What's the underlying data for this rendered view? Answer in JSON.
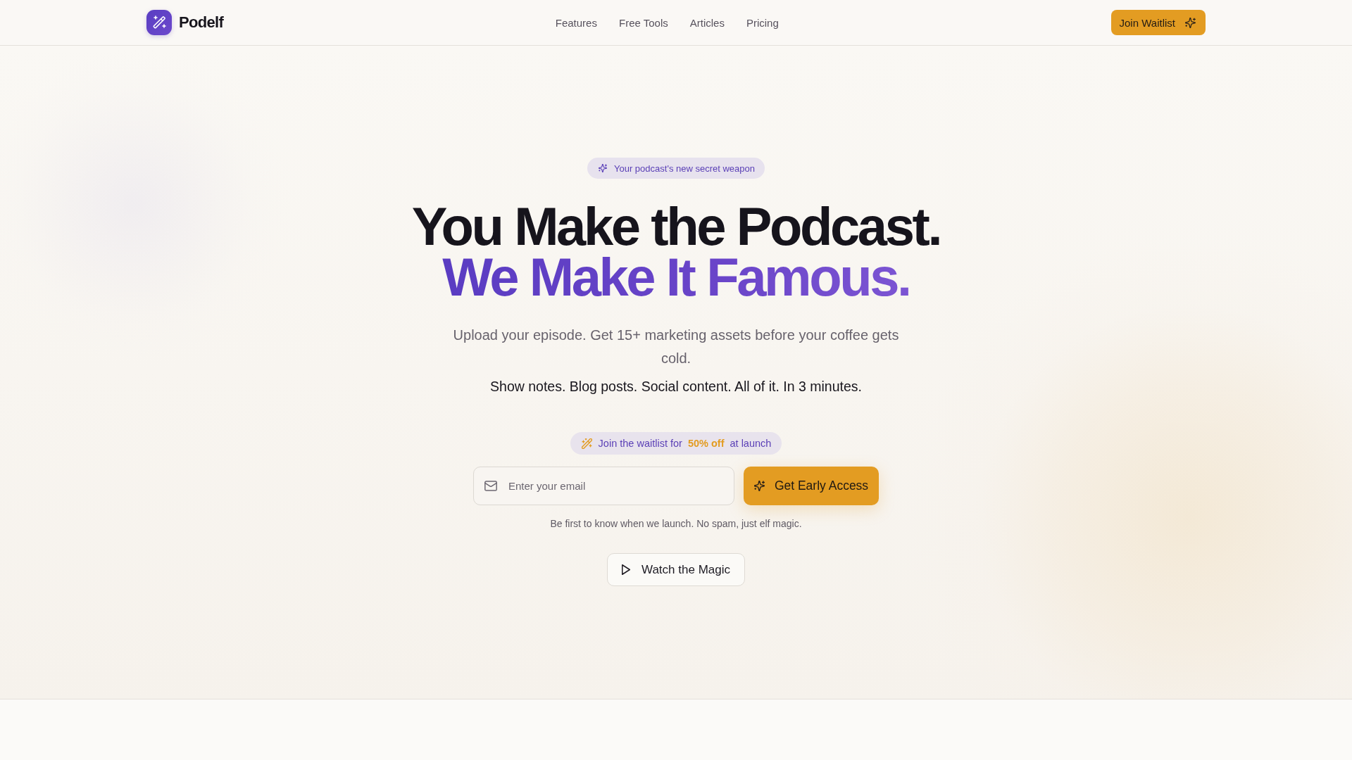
{
  "header": {
    "brand": "Podelf",
    "nav": [
      "Features",
      "Free Tools",
      "Articles",
      "Pricing"
    ],
    "cta": "Join Waitlist"
  },
  "hero": {
    "badge": "Your podcast's new secret weapon",
    "headline": {
      "line_1": "You Make the Podcast.",
      "line_2": "We Make It Famous."
    },
    "subtitle": "Upload your episode. Get 15+ marketing assets before your coffee gets cold.",
    "tagline": "Show notes. Blog posts. Social content. All of it. In 3 minutes.",
    "offer_badge": "Join the waitlist for **50% off** at launch",
    "email_field": {
      "placeholder": "Enter your email"
    },
    "submit_button": "Get Early Access",
    "note": "Be first to know when we launch. No spam, just elf magic.",
    "video_button": "Watch the Magic"
  }
}
